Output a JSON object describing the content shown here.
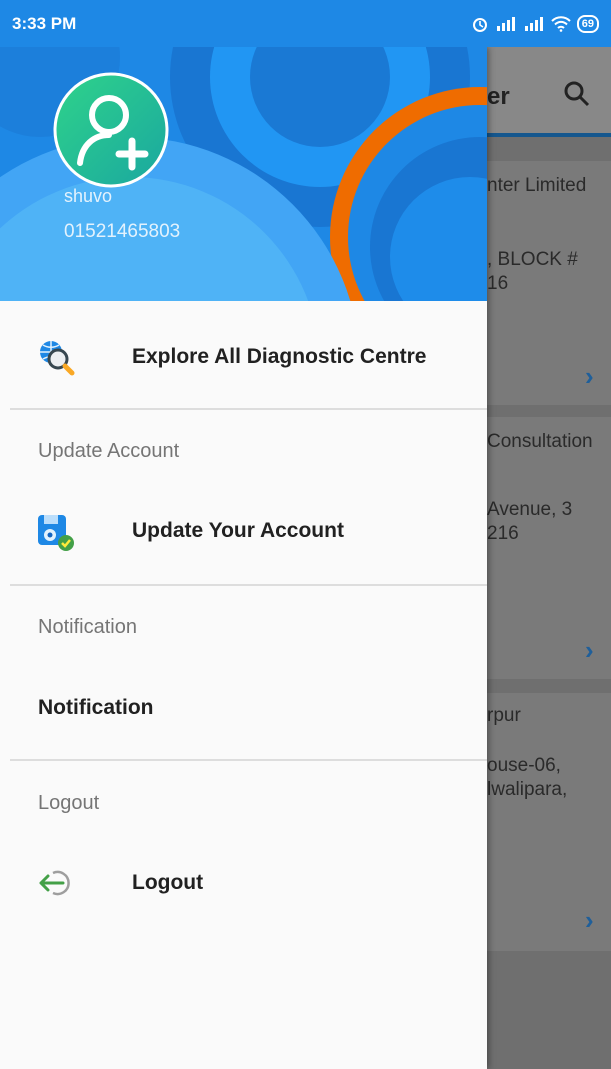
{
  "status_bar": {
    "time": "3:33 PM",
    "battery": "69"
  },
  "background_app": {
    "title_fragment": "er",
    "cards": [
      {
        "line1": "nter Limited",
        "line2": ", BLOCK #",
        "line3": "16"
      },
      {
        "line1": "Consultation",
        "line2": "Avenue, 3",
        "line3": "216"
      },
      {
        "line1": "rpur",
        "line2": "ouse-06,",
        "line3": "lwalipara,"
      }
    ]
  },
  "drawer": {
    "user": {
      "name": "shuvo",
      "phone": "01521465803"
    },
    "explore_label": "Explore All Diagnostic Centre",
    "update_section": "Update Account",
    "update_label": "Update Your Account",
    "notification_section": "Notification",
    "notification_label": "Notification",
    "logout_section": "Logout",
    "logout_label": "Logout"
  },
  "colors": {
    "primary": "#1e88e5",
    "accent_orange": "#ef6c00",
    "avatar_green": "#26c07a"
  }
}
